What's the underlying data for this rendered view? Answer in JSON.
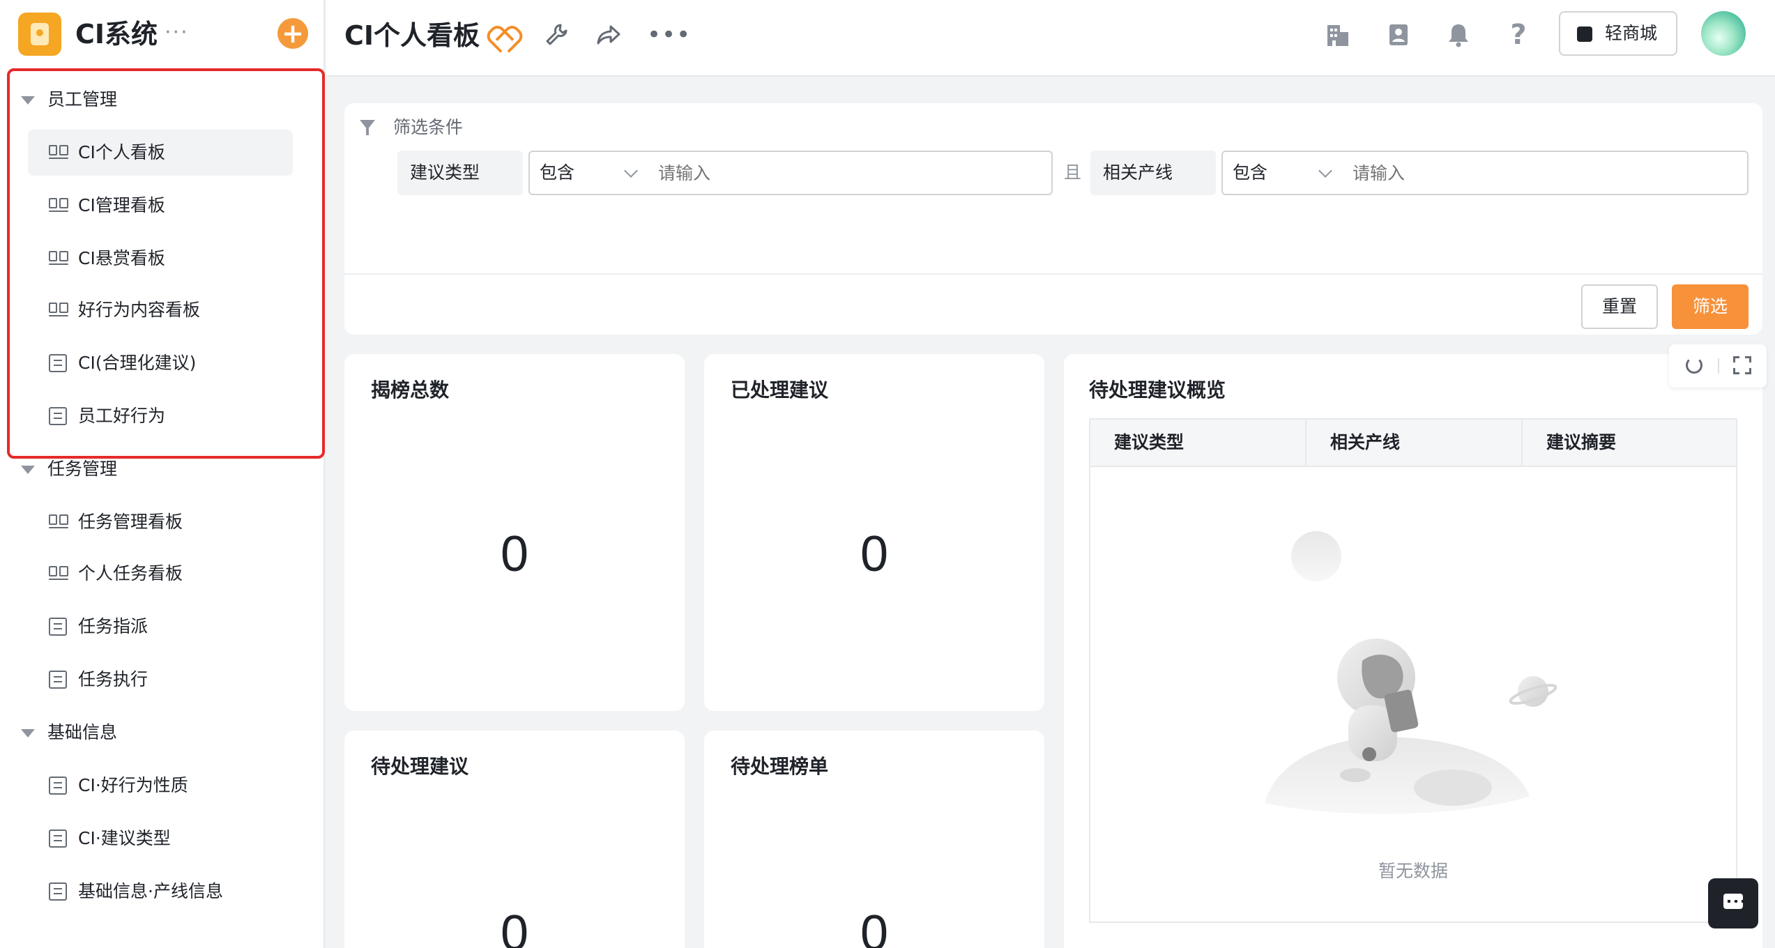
{
  "app": {
    "title": "CI系统",
    "more": "···",
    "add": "+"
  },
  "sidebar": {
    "groups": [
      {
        "label": "员工管理",
        "items": [
          {
            "label": "CI个人看板",
            "icon": "board-icon",
            "active": true
          },
          {
            "label": "CI管理看板",
            "icon": "board-icon"
          },
          {
            "label": "CI悬赏看板",
            "icon": "board-icon"
          },
          {
            "label": "好行为内容看板",
            "icon": "board-icon"
          },
          {
            "label": "CI(合理化建议)",
            "icon": "form-icon"
          },
          {
            "label": "员工好行为",
            "icon": "form-icon"
          }
        ]
      },
      {
        "label": "任务管理",
        "items": [
          {
            "label": "任务管理看板",
            "icon": "board-icon"
          },
          {
            "label": "个人任务看板",
            "icon": "board-icon"
          },
          {
            "label": "任务指派",
            "icon": "form-icon"
          },
          {
            "label": "任务执行",
            "icon": "form-icon"
          }
        ]
      },
      {
        "label": "基础信息",
        "items": [
          {
            "label": "CI·好行为性质",
            "icon": "form-icon"
          },
          {
            "label": "CI·建议类型",
            "icon": "form-icon"
          },
          {
            "label": "基础信息·产线信息",
            "icon": "form-icon"
          }
        ]
      }
    ]
  },
  "topbar": {
    "title": "CI个人看板",
    "more": "•••",
    "help": "?",
    "store_label": "轻商城"
  },
  "filter": {
    "title": "筛选条件",
    "conditions": [
      {
        "field": "建议类型",
        "operator": "包含",
        "placeholder": "请输入"
      },
      {
        "field": "相关产线",
        "operator": "包含",
        "placeholder": "请输入"
      }
    ],
    "joiner": "且",
    "reset_label": "重置",
    "apply_label": "筛选"
  },
  "cards": [
    {
      "title": "揭榜总数",
      "value": "0"
    },
    {
      "title": "已处理建议",
      "value": "0"
    },
    {
      "title": "待处理建议",
      "value": "0"
    },
    {
      "title": "待处理榜单",
      "value": "0"
    }
  ],
  "table": {
    "title": "待处理建议概览",
    "columns": [
      "建议类型",
      "相关产线",
      "建议摘要"
    ],
    "empty_text": "暂无数据"
  },
  "colors": {
    "accent": "#f7913a",
    "highlight": "#e52a2a"
  }
}
